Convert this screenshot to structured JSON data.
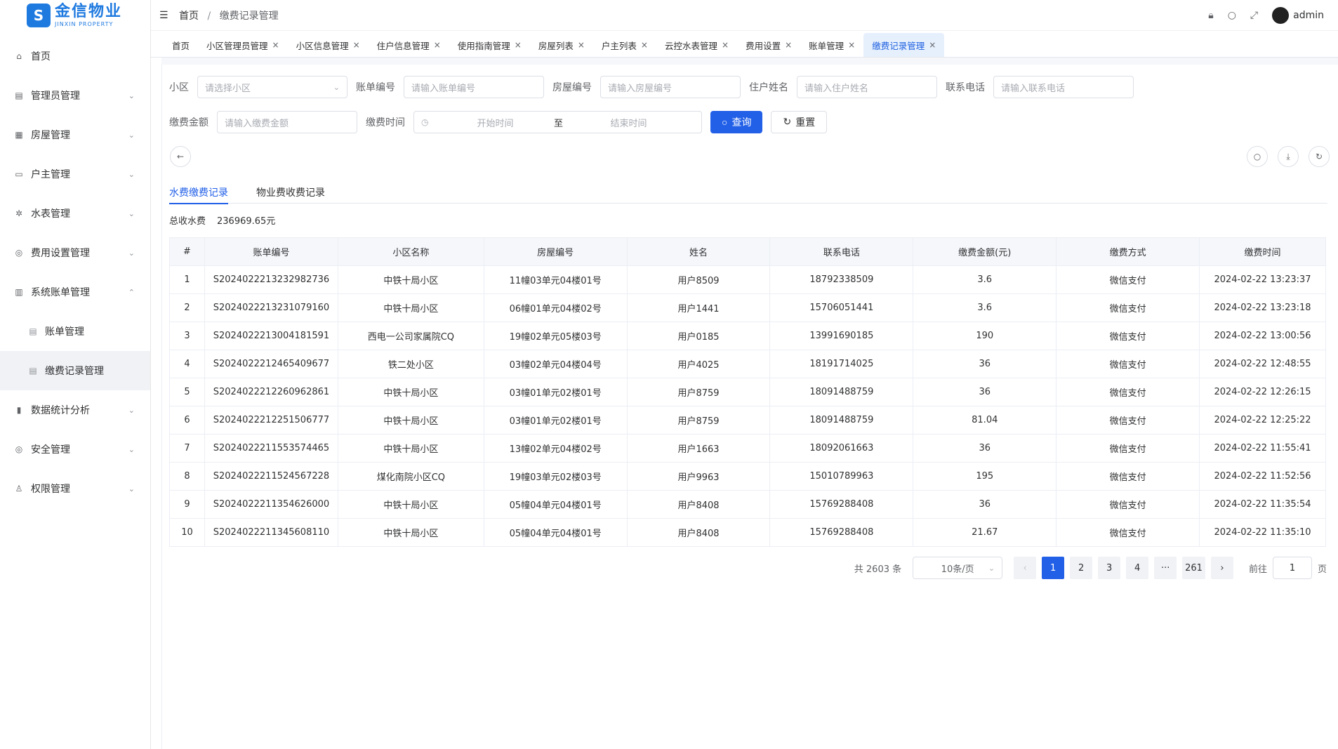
{
  "logo": {
    "mark": "S",
    "cn": "金信物业",
    "en": "JINXIN PROPERTY"
  },
  "sidebar": {
    "items": [
      {
        "icon": "⌂",
        "label": "首页",
        "chevron": ""
      },
      {
        "icon": "▤",
        "label": "管理员管理",
        "chevron": "⌄"
      },
      {
        "icon": "▦",
        "label": "房屋管理",
        "chevron": "⌄"
      },
      {
        "icon": "▭",
        "label": "户主管理",
        "chevron": "⌄"
      },
      {
        "icon": "✲",
        "label": "水表管理",
        "chevron": "⌄"
      },
      {
        "icon": "◎",
        "label": "费用设置管理",
        "chevron": "⌄"
      },
      {
        "icon": "▥",
        "label": "系统账单管理",
        "chevron": "⌃"
      }
    ],
    "sub_items": [
      {
        "icon": "▤",
        "label": "账单管理"
      },
      {
        "icon": "▤",
        "label": "缴费记录管理"
      }
    ],
    "items_after": [
      {
        "icon": "▮",
        "label": "数据统计分析",
        "chevron": "⌄"
      },
      {
        "icon": "◎",
        "label": "安全管理",
        "chevron": "⌄"
      },
      {
        "icon": "♙",
        "label": "权限管理",
        "chevron": "⌄"
      }
    ]
  },
  "header": {
    "breadcrumb_home": "首页",
    "breadcrumb_sep": "/",
    "breadcrumb_current": "缴费记录管理",
    "username": "admin"
  },
  "tabs": [
    {
      "label": "首页",
      "closable": false
    },
    {
      "label": "小区管理员管理",
      "closable": true
    },
    {
      "label": "小区信息管理",
      "closable": true
    },
    {
      "label": "住户信息管理",
      "closable": true
    },
    {
      "label": "使用指南管理",
      "closable": true
    },
    {
      "label": "房屋列表",
      "closable": true
    },
    {
      "label": "户主列表",
      "closable": true
    },
    {
      "label": "云控水表管理",
      "closable": true
    },
    {
      "label": "费用设置",
      "closable": true
    },
    {
      "label": "账单管理",
      "closable": true
    },
    {
      "label": "缴费记录管理",
      "closable": true,
      "active": true
    }
  ],
  "search": {
    "community_label": "小区",
    "community_placeholder": "请选择小区",
    "bill_no_label": "账单编号",
    "bill_no_placeholder": "请输入账单编号",
    "house_no_label": "房屋编号",
    "house_no_placeholder": "请输入房屋编号",
    "resident_label": "住户姓名",
    "resident_placeholder": "请输入住户姓名",
    "phone_label": "联系电话",
    "phone_placeholder": "请输入联系电话",
    "amount_label": "缴费金额",
    "amount_placeholder": "请输入缴费金额",
    "time_label": "缴费时间",
    "time_start_placeholder": "开始时间",
    "time_sep": "至",
    "time_end_placeholder": "结束时间",
    "query_label": "查询",
    "reset_label": "重置"
  },
  "subtabs": {
    "water": "水费缴费记录",
    "property": "物业费收费记录"
  },
  "summary": {
    "label": "总收水费",
    "value": "236969.65元"
  },
  "table": {
    "headers": [
      "#",
      "账单编号",
      "小区名称",
      "房屋编号",
      "姓名",
      "联系电话",
      "缴费金额(元)",
      "缴费方式",
      "缴费时间"
    ],
    "rows": [
      [
        "1",
        "S2024022213232982736",
        "中铁十局小区",
        "11幢03单元04楼01号",
        "用户8509",
        "18792338509",
        "3.6",
        "微信支付",
        "2024-02-22 13:23:37"
      ],
      [
        "2",
        "S2024022213231079160",
        "中铁十局小区",
        "06幢01单元04楼02号",
        "用户1441",
        "15706051441",
        "3.6",
        "微信支付",
        "2024-02-22 13:23:18"
      ],
      [
        "3",
        "S2024022213004181591",
        "西电一公司家属院CQ",
        "19幢02单元05楼03号",
        "用户0185",
        "13991690185",
        "190",
        "微信支付",
        "2024-02-22 13:00:56"
      ],
      [
        "4",
        "S2024022212465409677",
        "铁二处小区",
        "03幢02单元04楼04号",
        "用户4025",
        "18191714025",
        "36",
        "微信支付",
        "2024-02-22 12:48:55"
      ],
      [
        "5",
        "S2024022212260962861",
        "中铁十局小区",
        "03幢01单元02楼01号",
        "用户8759",
        "18091488759",
        "36",
        "微信支付",
        "2024-02-22 12:26:15"
      ],
      [
        "6",
        "S2024022212251506777",
        "中铁十局小区",
        "03幢01单元02楼01号",
        "用户8759",
        "18091488759",
        "81.04",
        "微信支付",
        "2024-02-22 12:25:22"
      ],
      [
        "7",
        "S2024022211553574465",
        "中铁十局小区",
        "13幢02单元04楼02号",
        "用户1663",
        "18092061663",
        "36",
        "微信支付",
        "2024-02-22 11:55:41"
      ],
      [
        "8",
        "S2024022211524567228",
        "煤化南院小区CQ",
        "19幢03单元02楼03号",
        "用户9963",
        "15010789963",
        "195",
        "微信支付",
        "2024-02-22 11:52:56"
      ],
      [
        "9",
        "S2024022211354626000",
        "中铁十局小区",
        "05幢04单元04楼01号",
        "用户8408",
        "15769288408",
        "36",
        "微信支付",
        "2024-02-22 11:35:54"
      ],
      [
        "10",
        "S2024022211345608110",
        "中铁十局小区",
        "05幢04单元04楼01号",
        "用户8408",
        "15769288408",
        "21.67",
        "微信支付",
        "2024-02-22 11:35:10"
      ]
    ]
  },
  "pagination": {
    "total_text": "共 2603 条",
    "page_size": "10条/页",
    "prev": "‹",
    "pages": [
      "1",
      "2",
      "3",
      "4"
    ],
    "ellipsis": "···",
    "last": "261",
    "next": "›",
    "goto_label": "前往",
    "goto_value": "1",
    "goto_suffix": "页"
  }
}
